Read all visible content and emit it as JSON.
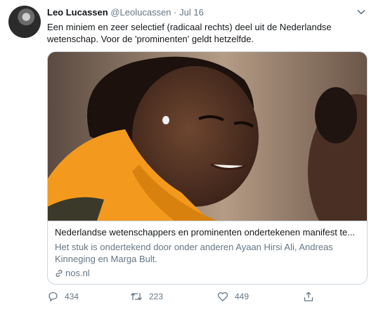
{
  "tweet": {
    "name": "Leo Lucassen",
    "handle": "@Leolucassen",
    "separator": "·",
    "date": "Jul 16",
    "text": "Een miniem en zeer selectief (radicaal rechts) deel uit de Nederlandse wetenschap. Voor de 'prominenten' geldt hetzelfde."
  },
  "card": {
    "title": "Nederlandse wetenschappers en prominenten ondertekenen manifest te...",
    "description": "Het stuk is ondertekend door onder anderen Ayaan Hirsi Ali, Andreas Kinneging en Marga Bult.",
    "domain": "nos.nl"
  },
  "actions": {
    "reply_count": "434",
    "retweet_count": "223",
    "like_count": "449"
  },
  "colors": {
    "secondary_text": "#657786",
    "border": "#ccd6dd",
    "scarf": "#f39a1e"
  },
  "icons": [
    "chevron-down-icon",
    "link-icon",
    "reply-icon",
    "retweet-icon",
    "like-icon",
    "share-icon"
  ]
}
